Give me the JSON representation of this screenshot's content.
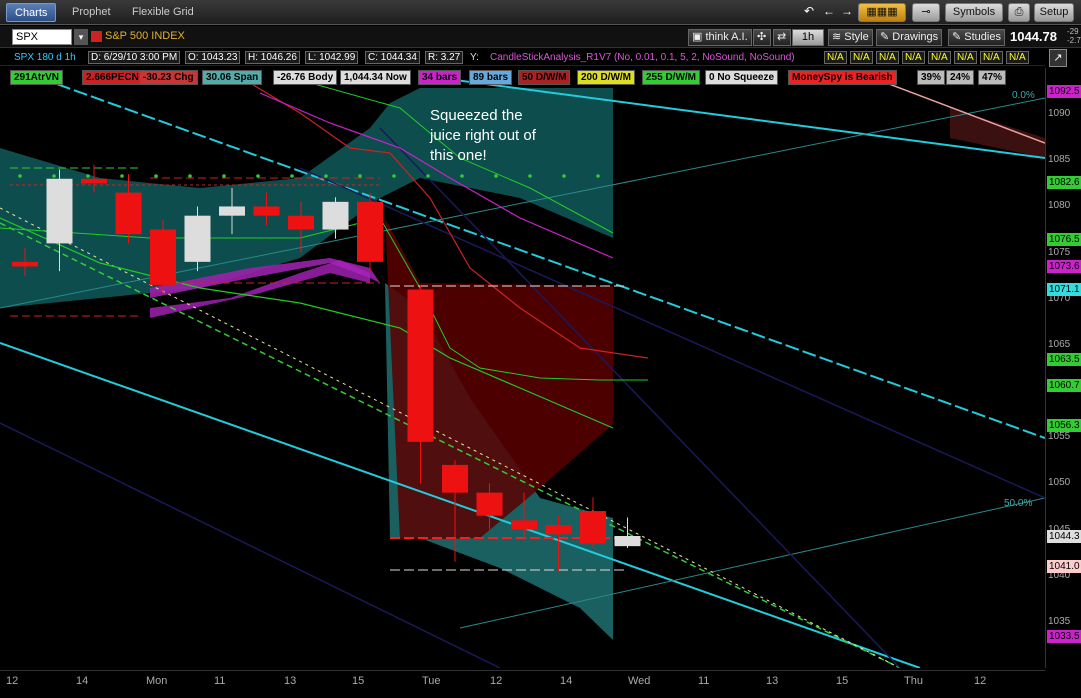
{
  "tabs": [
    {
      "label": "Charts",
      "active": true
    },
    {
      "label": "Prophet",
      "active": false
    },
    {
      "label": "Flexible Grid",
      "active": false
    }
  ],
  "toolbar": {
    "symbols_label": "Symbols",
    "setup_label": "Setup"
  },
  "symbol_bar": {
    "symbol": "SPX",
    "symbol_name": "S&P 500 INDEX",
    "think_ai_label": "think A.I.",
    "timeframe": "1h",
    "style_label": "Style",
    "drawings_label": "Drawings",
    "studies_label": "Studies",
    "last_price": "1044.78",
    "change_top": "-29",
    "change_bottom": "-2.7"
  },
  "info_bar": {
    "chart_id": "SPX 180 d 1h",
    "date": "D: 6/29/10 3:00 PM",
    "open": "O: 1043.23",
    "high": "H: 1046.26",
    "low": "L: 1042.99",
    "close": "C: 1044.34",
    "range": "R: 3.27",
    "y_label": "Y:",
    "study": "CandleStickAnalysis_R1V7 (No, 0.01, 0.1, 5, 2, NoSound, NoSound)",
    "na_values": [
      "N/A",
      "N/A",
      "N/A",
      "N/A",
      "N/A",
      "N/A",
      "N/A",
      "N/A"
    ]
  },
  "badges": [
    {
      "text": "291AtrVN",
      "bg": "#33cc33"
    },
    {
      "text": "2.666PECN",
      "bg": "#cc2222"
    },
    {
      "text": "-30.23 Chg",
      "bg": "#cc3333"
    },
    {
      "text": "30.06 Span",
      "bg": "#55aaaa"
    },
    {
      "text": "-26.76 Body",
      "bg": "#dddddd"
    },
    {
      "text": "1,044.34 Now",
      "bg": "#dddddd"
    },
    {
      "text": "34 bars",
      "bg": "#cc22cc"
    },
    {
      "text": "89 bars",
      "bg": "#66aadd"
    },
    {
      "text": "50 D/W/M",
      "bg": "#aa2222"
    },
    {
      "text": "200 D/W/M",
      "bg": "#dddd22"
    },
    {
      "text": "255 D/W/M",
      "bg": "#33cc33"
    },
    {
      "text": "0 No Squeeze",
      "bg": "#dddddd"
    },
    {
      "text": "MoneySpy is Bearish",
      "bg": "#ee2222"
    },
    {
      "text": "39%",
      "bg": "#bbbbbb"
    },
    {
      "text": "24%",
      "bg": "#bbbbbb"
    },
    {
      "text": "47%",
      "bg": "#bbbbbb"
    }
  ],
  "annotation": "Squeezed the juice right out of  this one!",
  "fib_labels": {
    "top": "0.0%",
    "mid": "50.0%"
  },
  "x_labels": [
    "12",
    "14",
    "Mon",
    "11",
    "13",
    "15",
    "Tue",
    "12",
    "14",
    "Wed",
    "11",
    "13",
    "15",
    "Thu",
    "12"
  ],
  "y_ticks": [
    "1090",
    "1085",
    "1080",
    "1075",
    "1070",
    "1065",
    "1055",
    "1050",
    "1045",
    "1040",
    "1035"
  ],
  "y_tags": [
    {
      "text": "1092.5",
      "bg": "#cc22cc"
    },
    {
      "text": "1082.6",
      "bg": "#33cc33"
    },
    {
      "text": "1076.5",
      "bg": "#33cc33"
    },
    {
      "text": "1073.6",
      "bg": "#cc22cc"
    },
    {
      "text": "1071.1",
      "bg": "#33dddd"
    },
    {
      "text": "1063.5",
      "bg": "#33cc33"
    },
    {
      "text": "1060.7",
      "bg": "#33cc33"
    },
    {
      "text": "1056.3",
      "bg": "#33cc33"
    },
    {
      "text": "1044.3",
      "bg": "#dddddd"
    },
    {
      "text": "1041.0",
      "bg": "#ffcccc"
    },
    {
      "text": "1033.5",
      "bg": "#cc22cc"
    }
  ],
  "chart_data": {
    "type": "candlestick",
    "candles": [
      {
        "o": 1074.0,
        "h": 1075.5,
        "l": 1072.5,
        "c": 1073.5,
        "up": false
      },
      {
        "o": 1076.0,
        "h": 1084.0,
        "l": 1073.0,
        "c": 1083.0,
        "up": true
      },
      {
        "o": 1083.0,
        "h": 1084.5,
        "l": 1081.5,
        "c": 1082.5,
        "up": false
      },
      {
        "o": 1081.5,
        "h": 1083.5,
        "l": 1076.0,
        "c": 1077.0,
        "up": false
      },
      {
        "o": 1077.5,
        "h": 1078.5,
        "l": 1070.5,
        "c": 1071.5,
        "up": false
      },
      {
        "o": 1074.0,
        "h": 1080.0,
        "l": 1073.0,
        "c": 1079.0,
        "up": true
      },
      {
        "o": 1079.0,
        "h": 1082.0,
        "l": 1077.0,
        "c": 1080.0,
        "up": true
      },
      {
        "o": 1080.0,
        "h": 1081.5,
        "l": 1078.0,
        "c": 1079.0,
        "up": false
      },
      {
        "o": 1079.0,
        "h": 1080.5,
        "l": 1075.0,
        "c": 1077.5,
        "up": false
      },
      {
        "o": 1077.5,
        "h": 1081.0,
        "l": 1076.5,
        "c": 1080.5,
        "up": true
      },
      {
        "o": 1080.5,
        "h": 1081.5,
        "l": 1073.0,
        "c": 1074.0,
        "up": false
      },
      {
        "o": 1071.0,
        "h": 1071.5,
        "l": 1050.0,
        "c": 1054.5,
        "up": false
      },
      {
        "o": 1052.0,
        "h": 1052.5,
        "l": 1041.5,
        "c": 1049.0,
        "up": false
      },
      {
        "o": 1049.0,
        "h": 1050.0,
        "l": 1045.0,
        "c": 1046.5,
        "up": false
      },
      {
        "o": 1046.0,
        "h": 1049.0,
        "l": 1044.0,
        "c": 1045.0,
        "up": false
      },
      {
        "o": 1045.5,
        "h": 1046.5,
        "l": 1040.5,
        "c": 1044.5,
        "up": false
      },
      {
        "o": 1047.0,
        "h": 1048.5,
        "l": 1043.0,
        "c": 1043.5,
        "up": false
      },
      {
        "o": 1043.2,
        "h": 1046.3,
        "l": 1043.0,
        "c": 1044.3,
        "up": true
      }
    ],
    "ylim": [
      1030,
      1095
    ]
  }
}
